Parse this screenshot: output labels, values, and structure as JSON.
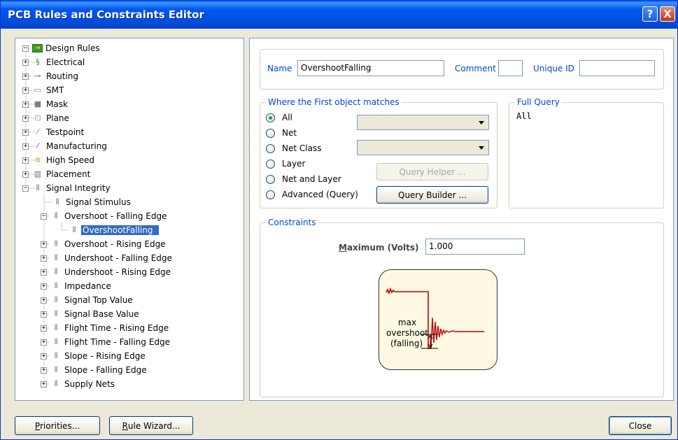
{
  "window": {
    "title": "PCB Rules and Constraints Editor",
    "help_glyph": "?",
    "close_glyph": "X"
  },
  "tree": {
    "root": "Design Rules",
    "items": [
      {
        "label": "Electrical",
        "icon": "electrical-icon"
      },
      {
        "label": "Routing",
        "icon": "routing-icon"
      },
      {
        "label": "SMT",
        "icon": "smt-icon"
      },
      {
        "label": "Mask",
        "icon": "mask-icon"
      },
      {
        "label": "Plane",
        "icon": "plane-icon"
      },
      {
        "label": "Testpoint",
        "icon": "testpoint-icon"
      },
      {
        "label": "Manufacturing",
        "icon": "manufacturing-icon"
      },
      {
        "label": "High Speed",
        "icon": "high-speed-icon"
      },
      {
        "label": "Placement",
        "icon": "placement-icon"
      },
      {
        "label": "Signal Integrity",
        "icon": "signal-icon"
      },
      {
        "label": "Signal Stimulus",
        "icon": "signal-icon"
      },
      {
        "label": "Overshoot - Falling Edge",
        "icon": "signal-icon"
      },
      {
        "label": "OvershootFalling",
        "icon": "signal-icon"
      },
      {
        "label": "Overshoot - Rising Edge",
        "icon": "signal-icon"
      },
      {
        "label": "Undershoot - Falling Edge",
        "icon": "signal-icon"
      },
      {
        "label": "Undershoot - Rising Edge",
        "icon": "signal-icon"
      },
      {
        "label": "Impedance",
        "icon": "signal-icon"
      },
      {
        "label": "Signal Top Value",
        "icon": "signal-icon"
      },
      {
        "label": "Signal Base Value",
        "icon": "signal-icon"
      },
      {
        "label": "Flight Time - Rising Edge",
        "icon": "signal-icon"
      },
      {
        "label": "Flight Time - Falling Edge",
        "icon": "signal-icon"
      },
      {
        "label": "Slope - Rising Edge",
        "icon": "signal-icon"
      },
      {
        "label": "Slope - Falling Edge",
        "icon": "signal-icon"
      },
      {
        "label": "Supply Nets",
        "icon": "signal-icon"
      }
    ]
  },
  "rule": {
    "name_label": "Name",
    "name_value": "OvershootFalling",
    "comment_label": "Comment",
    "comment_value": "",
    "unique_id_label": "Unique ID",
    "unique_id_value": ""
  },
  "first_object": {
    "title": "Where the First object matches",
    "options": [
      "All",
      "Net",
      "Net Class",
      "Layer",
      "Net and Layer",
      "Advanced (Query)"
    ],
    "selected": "All",
    "query_helper_label": "Query Helper ...",
    "query_builder_label": "Query Builder ..."
  },
  "full_query": {
    "title": "Full Query",
    "text": "All"
  },
  "constraints": {
    "title": "Constraints",
    "max_label": "Maximum (Volts)",
    "max_value": "1.000",
    "diagram_text_1": "max",
    "diagram_text_2": "overshoot",
    "diagram_text_3": "(falling)"
  },
  "footer": {
    "priorities_label": "Priorities...",
    "rule_wizard_label": "Rule Wizard...",
    "close_label": "Close"
  },
  "colors": {
    "title_bar": "#0054e3",
    "group_title": "#0046d5",
    "selection": "#316ac5",
    "waveform": "#c00000"
  }
}
